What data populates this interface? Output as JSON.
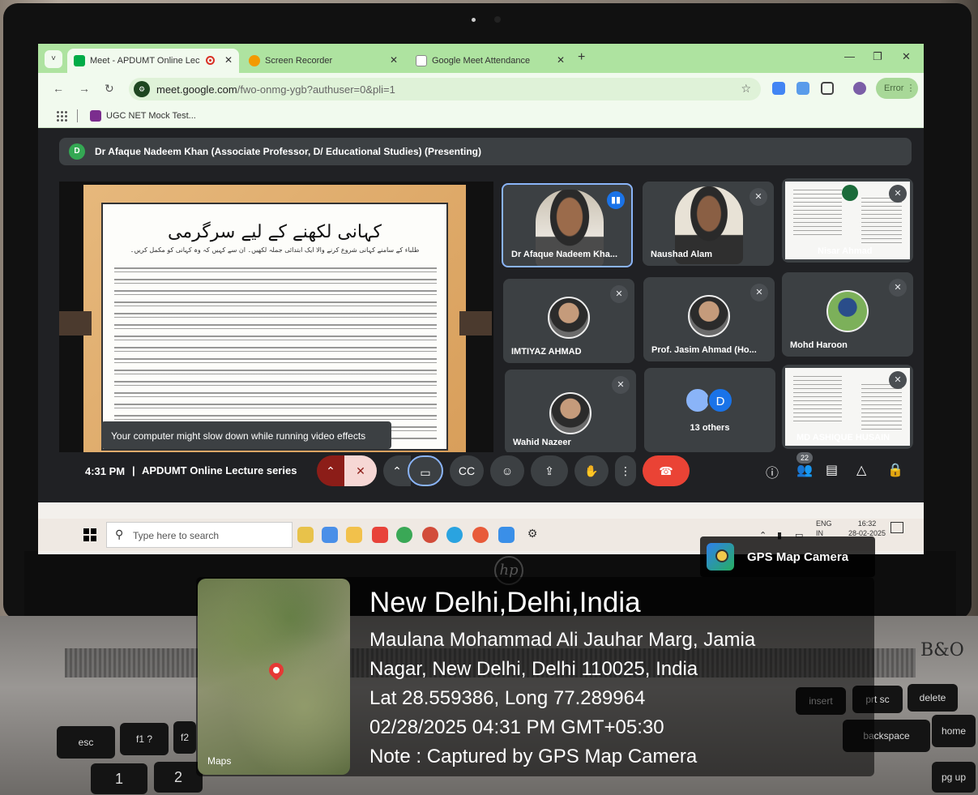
{
  "browser": {
    "tabs": [
      {
        "label": "Meet - APDUMT Online Lec",
        "active": true,
        "recording": true
      },
      {
        "label": "Screen Recorder",
        "active": false
      },
      {
        "label": "Google Meet Attendance",
        "active": false
      }
    ],
    "url_host": "meet.google.com",
    "url_path": "/fwo-onmg-ygb?authuser=0&pli=1",
    "error_label": "Error",
    "bookmark_label": "UGC NET Mock Test..."
  },
  "meet": {
    "presenter_initial": "D",
    "presenting_banner": "Dr Afaque Nadeem Khan (Associate Professor, D/ Educational Studies) (Presenting)",
    "slide": {
      "title": "کہانی لکھنے کے لیے سرگرمی",
      "subtitle": "طلباء کے سامنے کہانی شروع کرنے والا ایک ابتدائی جملہ لکھیں۔ ان سے کہیں کہ وہ کہانی کو مکمل کریں۔"
    },
    "toast": "Your computer might slow down while running video effects",
    "participants": [
      {
        "name": "Dr Afaque Nadeem Kha...",
        "state": "speaking"
      },
      {
        "name": "Naushad Alam",
        "state": "muted"
      },
      {
        "name": "Nisar Ahmad",
        "state": "muted"
      },
      {
        "name": "IMTIYAZ AHMAD",
        "state": "muted"
      },
      {
        "name": "Prof. Jasim Ahmad (Ho...",
        "state": "muted"
      },
      {
        "name": "Mohd Haroon",
        "state": "muted"
      },
      {
        "name": "Wahid Nazeer",
        "state": "muted"
      },
      {
        "name": "13 others",
        "state": "group",
        "initial": "D"
      },
      {
        "name": "MD ASHIQUE HUSAIN",
        "state": "muted"
      }
    ],
    "time": "4:31 PM",
    "separator": "|",
    "meeting_title": "APDUMT Online Lecture series",
    "people_count": "22"
  },
  "taskbar": {
    "search_placeholder": "Type here to search",
    "lang_top": "ENG",
    "lang_bottom": "IN",
    "clock_time": "16:32",
    "clock_date": "28-02-2025"
  },
  "gps": {
    "badge": "GPS Map Camera",
    "maps_label": "Maps",
    "title": "New Delhi,Delhi,India",
    "address_line1": "Maulana Mohammad Ali Jauhar Marg, Jamia",
    "address_line2": "Nagar, New Delhi, Delhi 110025, India",
    "coords": "Lat 28.559386, Long 77.289964",
    "datetime": "02/28/2025 04:31 PM GMT+05:30",
    "note": "Note : Captured by GPS Map Camera"
  },
  "keyboard": {
    "keys": [
      "esc",
      "f1 ?",
      "f2",
      "insert",
      "prt sc",
      "delete",
      "backspace",
      "home",
      "pg up",
      "1",
      "2",
      "@"
    ]
  },
  "colors": {
    "tabbar": "#aee3a0",
    "meet_bg": "#202124",
    "end_call": "#ea4335",
    "active_border": "#8ab4f8"
  }
}
